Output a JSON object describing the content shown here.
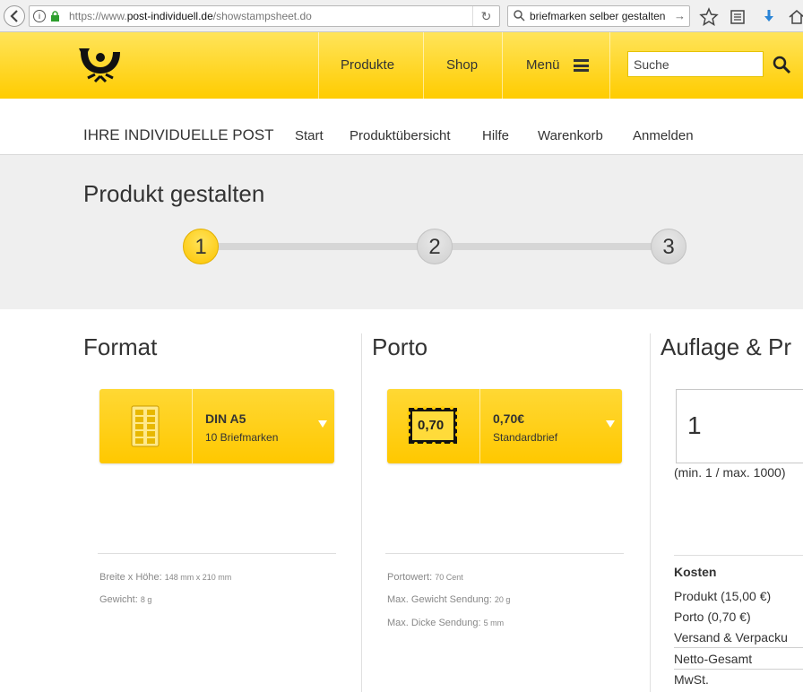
{
  "browser": {
    "url_prefix": "https://www.",
    "url_domain": "post-individuell.de",
    "url_path": "/showstampsheet.do",
    "search_text": "briefmarken selber gestalten"
  },
  "header": {
    "nav": [
      {
        "label": "Produkte"
      },
      {
        "label": "Shop"
      },
      {
        "label": "Menü"
      }
    ],
    "search_placeholder": "Suche"
  },
  "subnav": {
    "brand": "IHRE INDIVIDUELLE POST",
    "links": [
      "Start",
      "Produktübersicht",
      "Hilfe",
      "Warenkorb",
      "Anmelden"
    ]
  },
  "banner": {
    "title": "Produkt gestalten",
    "steps": [
      "1",
      "2",
      "3"
    ],
    "active_step": 1
  },
  "format": {
    "title": "Format",
    "selected": "DIN A5",
    "sub": "10 Briefmarken",
    "info": [
      {
        "label": "Breite x Höhe:",
        "value": "148 mm x 210 mm"
      },
      {
        "label": "Gewicht:",
        "value": "8 g"
      }
    ]
  },
  "porto": {
    "title": "Porto",
    "stamp_value": "0,70",
    "selected": "0,70€",
    "sub": "Standardbrief",
    "info": [
      {
        "label": "Portowert:",
        "value": "70 Cent"
      },
      {
        "label": "Max. Gewicht Sendung:",
        "value": "20 g"
      },
      {
        "label": "Max. Dicke Sendung:",
        "value": "5 mm"
      }
    ]
  },
  "auflage": {
    "title": "Auflage & Pr",
    "quantity": "1",
    "hint": "(min. 1 / max. 1000)",
    "costs_head": "Kosten",
    "cost_rows": [
      "Produkt (15,00 €)",
      "Porto (0,70 €)",
      "Versand & Verpacku",
      "Netto-Gesamt",
      "MwSt."
    ]
  },
  "colors": {
    "accent_yellow": "#ffcc00",
    "text": "#333333"
  }
}
